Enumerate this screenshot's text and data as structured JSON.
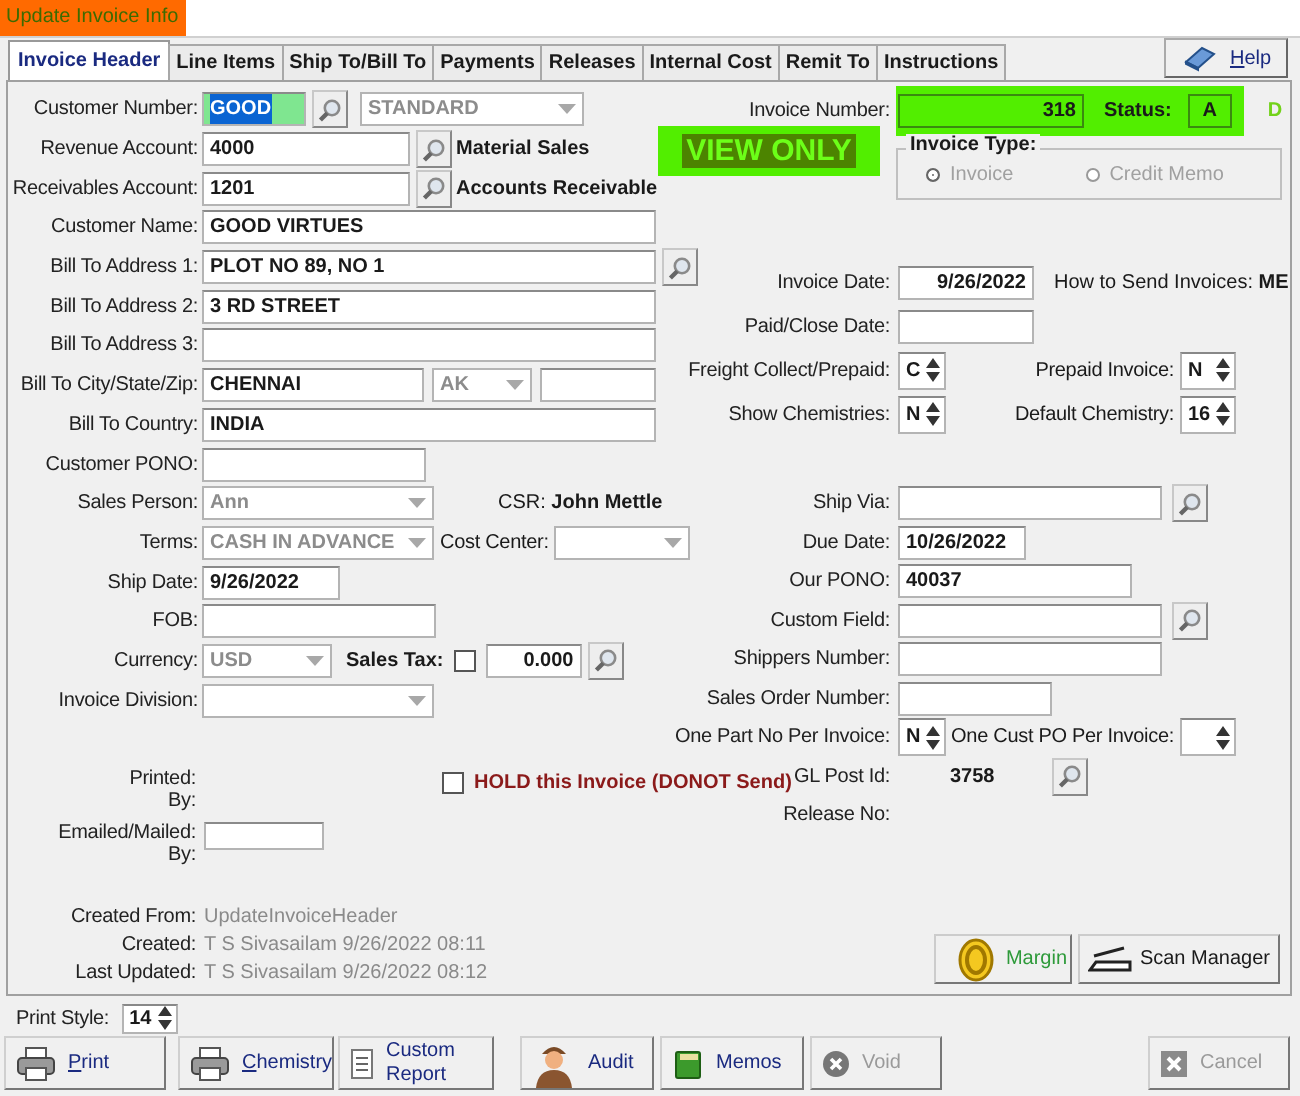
{
  "window": {
    "title": "Update Invoice Info"
  },
  "tabs": [
    {
      "label": "Invoice Header",
      "selected": true
    },
    {
      "label": "Line Items",
      "selected": false
    },
    {
      "label": "Ship To/Bill To",
      "selected": false
    },
    {
      "label": "Payments",
      "selected": false
    },
    {
      "label": "Releases",
      "selected": false
    },
    {
      "label": "Internal Cost",
      "selected": false
    },
    {
      "label": "Remit To",
      "selected": false
    },
    {
      "label": "Instructions",
      "selected": false
    }
  ],
  "help_button": {
    "label": "Help",
    "mnemonic": true
  },
  "left_rows": [
    {
      "label": "Customer Number:",
      "controls": [
        {
          "kind": "input",
          "value": "GOOD",
          "focused": true
        },
        {
          "kind": "search"
        },
        {
          "kind": "combo",
          "value": "STANDARD",
          "disabled": true
        }
      ]
    },
    {
      "label": "Revenue Account:",
      "controls": [
        {
          "kind": "input",
          "value": "4000"
        },
        {
          "kind": "search"
        },
        {
          "kind": "bold_text",
          "text": "Material Sales"
        }
      ]
    },
    {
      "label": "Receivables Account:",
      "controls": [
        {
          "kind": "input",
          "value": "1201"
        },
        {
          "kind": "search"
        },
        {
          "kind": "bold_text",
          "text": "Accounts Receivable"
        }
      ]
    },
    {
      "label": "Customer Name:",
      "controls": [
        {
          "kind": "input",
          "value": "GOOD VIRTUES"
        }
      ]
    },
    {
      "label": "Bill To Address 1:",
      "controls": [
        {
          "kind": "input",
          "value": "PLOT NO 89, NO 1"
        },
        {
          "kind": "search"
        }
      ]
    },
    {
      "label": "Bill To Address 2:",
      "controls": [
        {
          "kind": "input",
          "value": "3 RD STREET"
        }
      ]
    },
    {
      "label": "Bill To Address 3:",
      "controls": [
        {
          "kind": "input"
        }
      ]
    },
    {
      "label": "Bill To City/State/Zip:",
      "controls": [
        {
          "kind": "input",
          "value": "CHENNAI"
        },
        {
          "kind": "combo",
          "value": "AK",
          "disabled": true
        },
        {
          "kind": "input"
        }
      ]
    },
    {
      "label": "Bill To Country:",
      "controls": [
        {
          "kind": "input",
          "value": "INDIA"
        }
      ]
    },
    {
      "label": "Customer PONO:",
      "controls": [
        {
          "kind": "input"
        }
      ]
    },
    {
      "label": "Sales Person:",
      "controls": [
        {
          "kind": "combo",
          "value": "Ann",
          "disabled": true
        },
        {
          "kind": "text",
          "text": "CSR: **John Mettle**"
        }
      ]
    },
    {
      "label": "Terms:",
      "controls": [
        {
          "kind": "combo",
          "value": "CASH IN ADVANCE",
          "disabled": true
        },
        {
          "kind": "label",
          "text": "Cost Center:"
        },
        {
          "kind": "combo",
          "disabled": true
        }
      ]
    },
    {
      "label": "Ship Date:",
      "controls": [
        {
          "kind": "input",
          "value": "9/26/2022"
        }
      ]
    },
    {
      "label": "FOB:",
      "controls": [
        {
          "kind": "input"
        }
      ]
    },
    {
      "label": "Currency:",
      "controls": [
        {
          "kind": "combo",
          "value": "USD",
          "disabled": true
        },
        {
          "kind": "bold_text",
          "text": "Sales Tax:"
        },
        {
          "kind": "checkbox",
          "checked": false
        },
        {
          "kind": "input",
          "value": "0.000"
        },
        {
          "kind": "search"
        }
      ]
    },
    {
      "label": "Invoice Division:",
      "controls": [
        {
          "kind": "combo",
          "disabled": true
        }
      ]
    }
  ],
  "printed": {
    "label": [
      "Printed:",
      "By:"
    ]
  },
  "hold": {
    "label": "HOLD this Invoice (DONOT Send)",
    "checked": false
  },
  "emailed": {
    "label": [
      "Emailed/Mailed:",
      "By:"
    ]
  },
  "audit_info": [
    {
      "label": "Created From:",
      "value": "UpdateInvoiceHeader"
    },
    {
      "label": "Created:",
      "value": "T S Sivasailam 9/26/2022 08:11"
    },
    {
      "label": "Last Updated:",
      "value": "T S Sivasailam 9/26/2022 08:12"
    }
  ],
  "invoice_number": {
    "label": "Invoice Number:",
    "value": "318",
    "status_label": "Status:",
    "status": "A",
    "status_flag": "D"
  },
  "view_only": "VIEW ONLY",
  "invoice_type": {
    "title": "Invoice Type:",
    "disabled": true,
    "options": [
      {
        "label": "Invoice",
        "selected": true
      },
      {
        "label": "Credit Memo",
        "selected": false
      }
    ]
  },
  "right_rows": [
    {
      "label": "Invoice Date:",
      "controls": [
        {
          "kind": "input",
          "value": "9/26/2022"
        },
        {
          "kind": "text",
          "text": "How to Send Invoices: **ME**"
        }
      ]
    },
    {
      "label": "Paid/Close Date:",
      "controls": [
        {
          "kind": "input"
        }
      ]
    },
    {
      "label": "Freight Collect/Prepaid:",
      "controls": [
        {
          "kind": "spin",
          "value": "C"
        },
        {
          "kind": "label",
          "text": "Prepaid Invoice:"
        },
        {
          "kind": "spin",
          "value": "N"
        }
      ]
    },
    {
      "label": "Show Chemistries:",
      "controls": [
        {
          "kind": "spin",
          "value": "N"
        },
        {
          "kind": "label",
          "text": "Default Chemistry:"
        },
        {
          "kind": "spin",
          "value": "16"
        }
      ]
    },
    {
      "label": "Ship Via:",
      "controls": [
        {
          "kind": "input"
        },
        {
          "kind": "search"
        }
      ]
    },
    {
      "label": "Due Date:",
      "controls": [
        {
          "kind": "input",
          "value": "10/26/2022"
        }
      ]
    },
    {
      "label": "Our PONO:",
      "controls": [
        {
          "kind": "input",
          "value": "40037"
        }
      ]
    },
    {
      "label": "Custom Field:",
      "controls": [
        {
          "kind": "input"
        },
        {
          "kind": "search"
        }
      ]
    },
    {
      "label": "Shippers Number:",
      "controls": [
        {
          "kind": "input"
        }
      ]
    },
    {
      "label": "Sales Order Number:",
      "controls": [
        {
          "kind": "input"
        }
      ]
    },
    {
      "label": "One Part No Per Invoice:",
      "controls": [
        {
          "kind": "spin",
          "value": "N"
        },
        {
          "kind": "label",
          "text": "One Cust PO Per Invoice:"
        },
        {
          "kind": "spin"
        }
      ]
    },
    {
      "label": "GL Post Id:",
      "controls": [
        {
          "kind": "bold_text",
          "text": "3758"
        },
        {
          "kind": "search"
        }
      ]
    },
    {
      "label": "Release No:",
      "controls": []
    }
  ],
  "side_buttons": [
    {
      "label": "Margin"
    },
    {
      "label": "Scan Manager"
    }
  ],
  "print_style": {
    "label": "Print Style:",
    "value": "14"
  },
  "buttons": [
    {
      "label": "Print",
      "mnemonic": true,
      "disabled": false
    },
    {
      "label": "Chemistry",
      "mnemonic": true,
      "disabled": false
    },
    {
      "label": "Custom Report",
      "mnemonic": false,
      "disabled": false
    },
    {
      "label": "Audit",
      "mnemonic": false,
      "disabled": false
    },
    {
      "label": "Memos",
      "mnemonic": false,
      "disabled": false
    },
    {
      "label": "Void",
      "mnemonic": false,
      "disabled": true
    },
    {
      "label": "Cancel",
      "mnemonic": false,
      "disabled": true
    }
  ]
}
